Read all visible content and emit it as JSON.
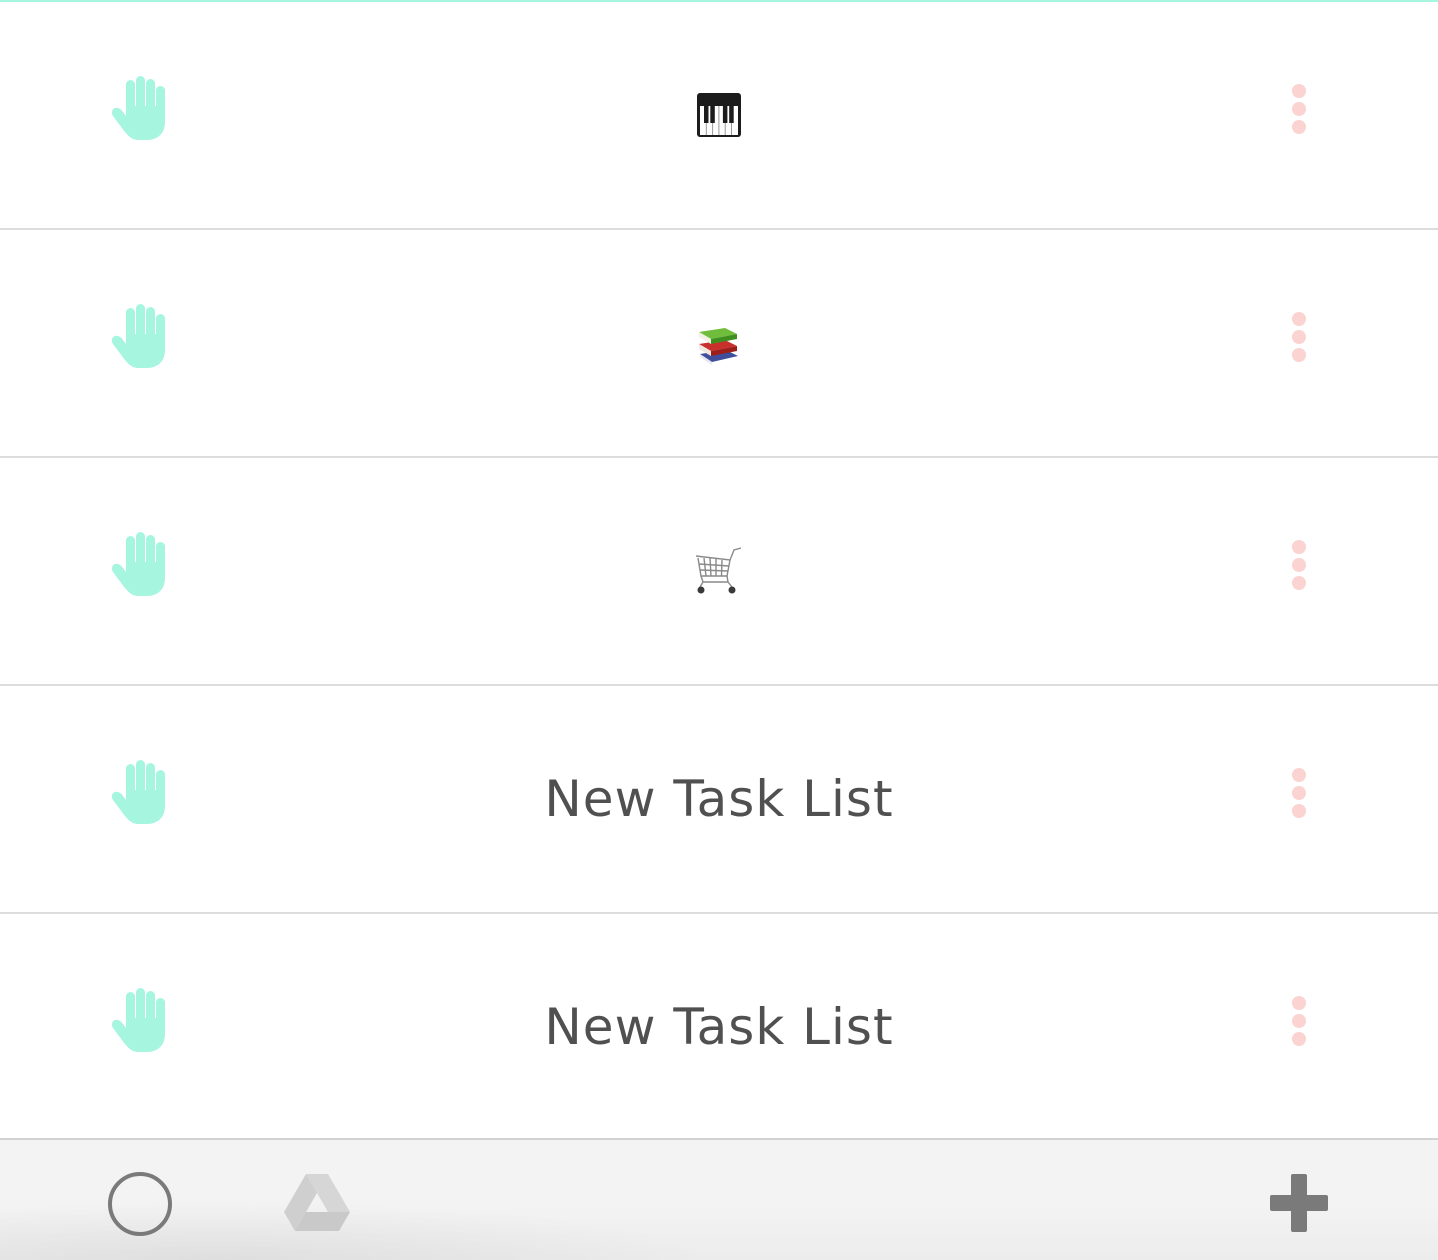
{
  "colors": {
    "accent": "#a6f5df",
    "kebab": "#fbd3d1",
    "title_text": "#505050",
    "icon_grey": "#7a7a7a",
    "drive_grey": "#d3d3d3",
    "divider": "#dcdcdc"
  },
  "lists": [
    {
      "kind": "emoji",
      "icon": "piano-keyboard-icon",
      "label": ""
    },
    {
      "kind": "emoji",
      "icon": "books-icon",
      "label": ""
    },
    {
      "kind": "emoji",
      "icon": "shopping-cart-icon",
      "label": ""
    },
    {
      "kind": "text",
      "icon": "",
      "label": "New Task List"
    },
    {
      "kind": "text",
      "icon": "",
      "label": "New Task List"
    }
  ],
  "row_controls": {
    "drag_icon": "hand-icon",
    "menu_icon": "kebab-menu-icon"
  },
  "bottom_bar": {
    "left_icon": "circle-icon",
    "middle_icon": "google-drive-icon",
    "right_icon": "plus-icon"
  }
}
